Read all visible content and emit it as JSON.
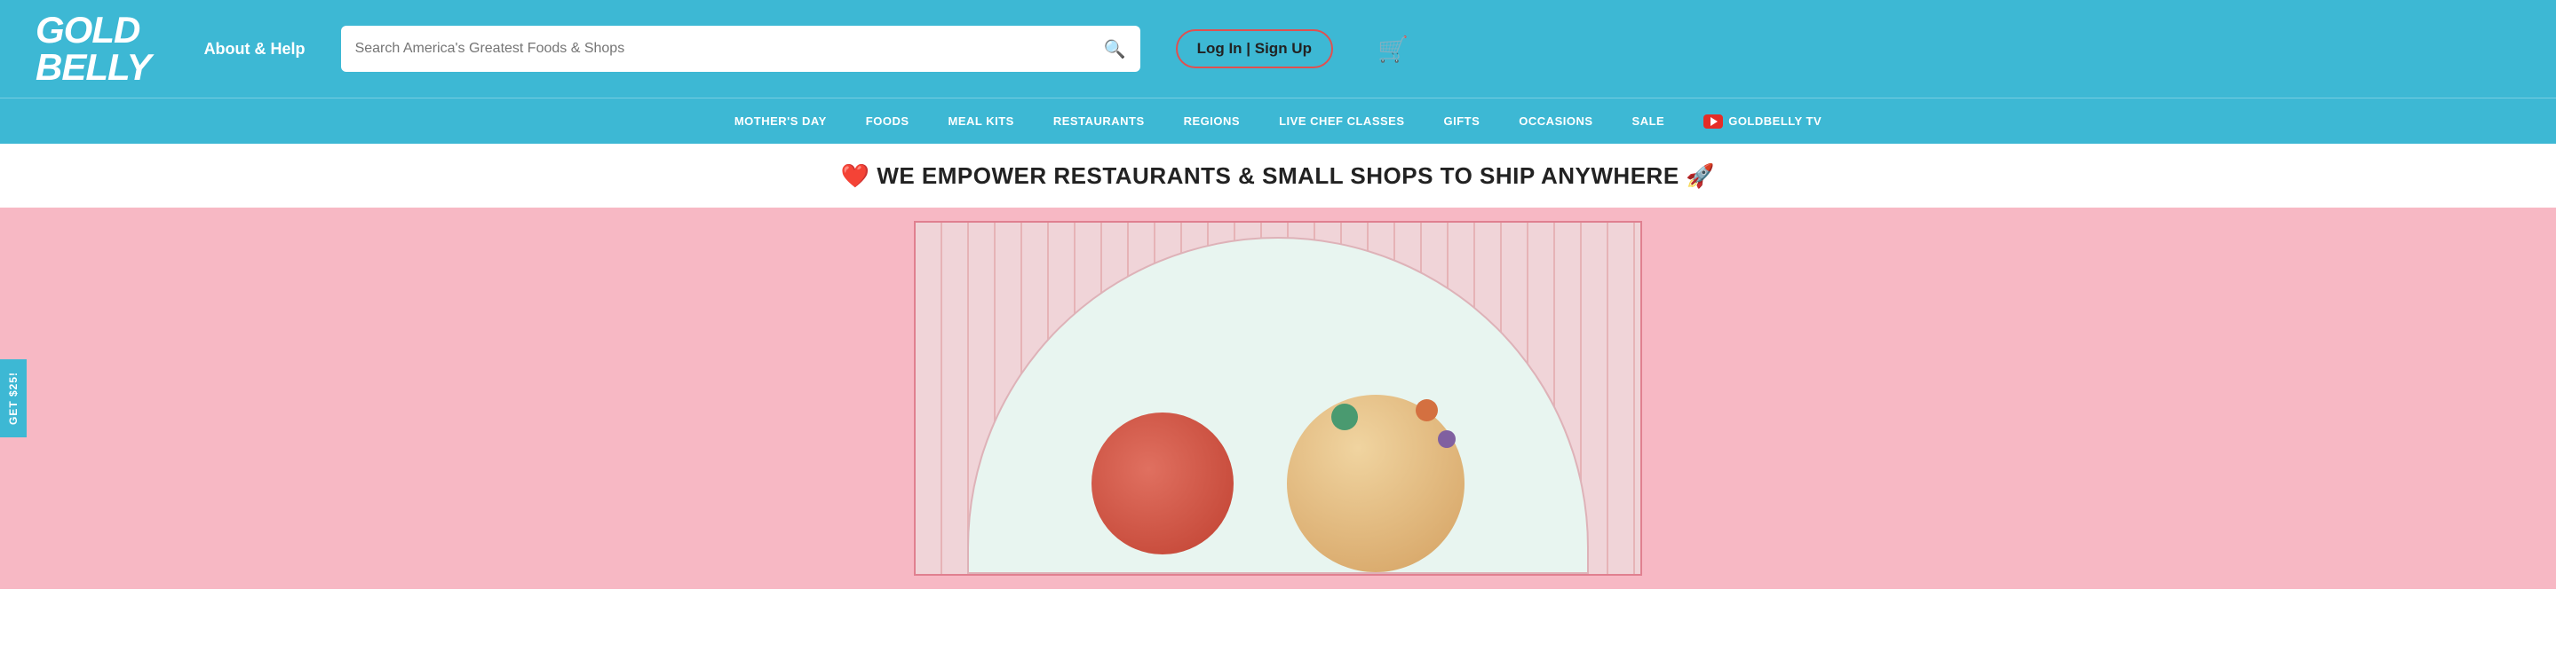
{
  "header": {
    "logo_top": "GOLD",
    "logo_bottom": "BELLY",
    "about_help": "About & Help",
    "search_placeholder": "Search America's Greatest Foods & Shops",
    "auth_label": "Log In | Sign Up",
    "cart_icon": "🛒"
  },
  "nav": {
    "items": [
      {
        "label": "MOTHER'S DAY",
        "id": "mothers-day"
      },
      {
        "label": "FOODS",
        "id": "foods"
      },
      {
        "label": "MEAL KITS",
        "id": "meal-kits"
      },
      {
        "label": "RESTAURANTS",
        "id": "restaurants"
      },
      {
        "label": "REGIONS",
        "id": "regions"
      },
      {
        "label": "LIVE CHEF CLASSES",
        "id": "live-chef-classes"
      },
      {
        "label": "GIFTS",
        "id": "gifts"
      },
      {
        "label": "OCCASIONS",
        "id": "occasions"
      },
      {
        "label": "SALE",
        "id": "sale"
      },
      {
        "label": "GOLDBELLY TV",
        "id": "goldbelly-tv",
        "has_yt": true
      }
    ]
  },
  "banner": {
    "text": "❤️ WE EMPOWER RESTAURANTS & SMALL SHOPS TO SHIP ANYWHERE 🚀"
  },
  "hero": {
    "side_tab": "GET $25!"
  }
}
